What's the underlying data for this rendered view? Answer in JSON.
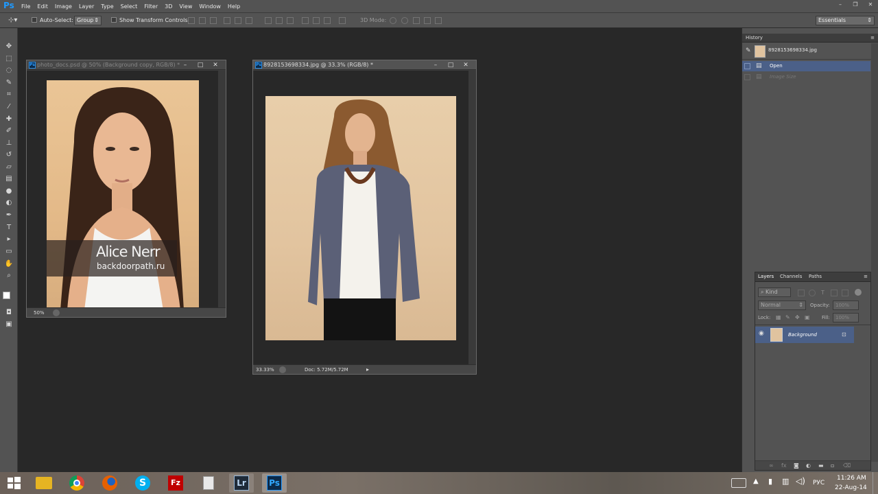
{
  "app": {
    "logo": "Ps"
  },
  "menu": [
    "File",
    "Edit",
    "Image",
    "Layer",
    "Type",
    "Select",
    "Filter",
    "3D",
    "View",
    "Window",
    "Help"
  ],
  "window_controls": {
    "minimize": "–",
    "restore": "❐",
    "close": "✕"
  },
  "options_bar": {
    "auto_select_label": "Auto-Select:",
    "auto_select_value": "Group",
    "transform_label": "Show Transform Controls",
    "mode_label": "3D Mode:",
    "workspace": "Essentials"
  },
  "doc1": {
    "title": "photo_docs.psd @ 50% (Background copy, RGB/8) *",
    "zoom": "50%",
    "watermark_name": "Alice Nerr",
    "watermark_site": "backdoorpath.ru"
  },
  "doc2": {
    "title": "8928153698334.jpg @ 33.3% (RGB/8) *",
    "zoom": "33.33%",
    "doc_size": "Doc: 5.72M/5.72M"
  },
  "history": {
    "title": "History",
    "snapshot": "8928153698334.jpg",
    "items": [
      {
        "label": "Open"
      },
      {
        "label": "Image Size"
      }
    ]
  },
  "layers": {
    "tabs": [
      "Layers",
      "Channels",
      "Paths"
    ],
    "kind": "Kind",
    "blend": "Normal",
    "opacity_label": "Opacity:",
    "opacity_value": "100%",
    "lock_label": "Lock:",
    "fill_label": "Fill:",
    "fill_value": "100%",
    "layer_name": "Background"
  },
  "taskbar": {
    "lang": "РУС",
    "time": "11:26 AM",
    "date": "22-Aug-14",
    "apps": [
      {
        "name": "windows-start",
        "color": "#1d7fd6"
      },
      {
        "name": "file-explorer",
        "color": "#e6b422"
      },
      {
        "name": "chrome",
        "color": "#db4437"
      },
      {
        "name": "firefox",
        "color": "#e66000"
      },
      {
        "name": "skype",
        "color": "#00aff0"
      },
      {
        "name": "filezilla",
        "color": "#bf0000"
      },
      {
        "name": "notepad",
        "color": "#d9d9d9"
      },
      {
        "name": "lightroom",
        "color": "#2b3b4e"
      },
      {
        "name": "photoshop",
        "color": "#0b2a4a"
      }
    ],
    "lr_label": "Lr",
    "ps_label": "Ps",
    "fz_label": "Fz"
  }
}
